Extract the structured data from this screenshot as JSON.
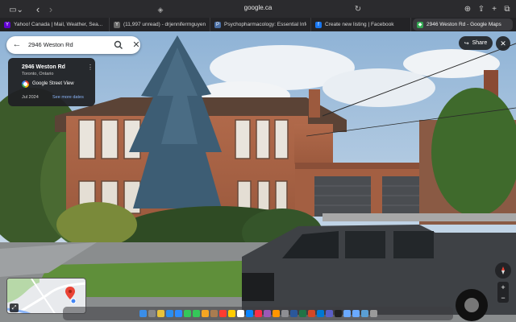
{
  "browser": {
    "url": "google.ca",
    "tabs": [
      {
        "label": "Yahoo! Canada | Mail, Weather, Sea...",
        "icon": "yahoo-icon",
        "color": "#6001d2"
      },
      {
        "label": "(11,997 unread) - drjenniferrnguyen...",
        "icon": "yahoo-mail-icon",
        "color": "#6a6a6a"
      },
      {
        "label": "Psychopharmacology: Essential Info...",
        "icon": "document-icon",
        "color": "#4a6fa5"
      },
      {
        "label": "Create new listing | Facebook",
        "icon": "facebook-icon",
        "color": "#1877f2"
      },
      {
        "label": "2946 Weston Rd - Google Maps",
        "icon": "google-maps-icon",
        "color": "#34a853",
        "active": true
      }
    ]
  },
  "maps": {
    "search": {
      "value": "2946 Weston Rd"
    },
    "info_card": {
      "title": "2946 Weston Rd",
      "subtitle": "Toronto, Ontario",
      "source": "Google Street View",
      "date": "Jul 2024",
      "see_more": "See more dates"
    },
    "share_label": "Share",
    "zoom_in": "+",
    "zoom_out": "−"
  },
  "colors": {
    "accent_link": "#8ab4f8",
    "chrome_bg": "#2b2b2e",
    "card_bg": "#202124"
  },
  "dock": {
    "icons": [
      "finder-icon",
      "launchpad-icon",
      "chrome-icon",
      "safari-icon",
      "zoom-icon",
      "messages-icon",
      "facetime-icon",
      "photos-icon",
      "contacts-icon",
      "calendar-icon",
      "notes-icon",
      "reminders-icon",
      "appstore-icon",
      "music-icon",
      "podcasts-icon",
      "books-icon",
      "settings-icon",
      "word-icon",
      "excel-icon",
      "powerpoint-icon",
      "outlook-icon",
      "teams-icon",
      "terminal-icon",
      "preview-icon",
      "folder-icon",
      "downloads-icon",
      "trash-icon"
    ],
    "colors": [
      "#3b8ee8",
      "#888",
      "#e8c33b",
      "#2a8df0",
      "#2d8cff",
      "#34c759",
      "#34c759",
      "#f5a623",
      "#a97c50",
      "#ff3b30",
      "#ffcc00",
      "#ffffff",
      "#0a84ff",
      "#fa2d48",
      "#9b59b6",
      "#ff9500",
      "#8e8e93",
      "#2b579a",
      "#217346",
      "#d24726",
      "#0078d4",
      "#5b5fc7",
      "#222",
      "#6aa9ff",
      "#6aa9ff",
      "#5a9fd4",
      "#9a9a9a"
    ]
  }
}
